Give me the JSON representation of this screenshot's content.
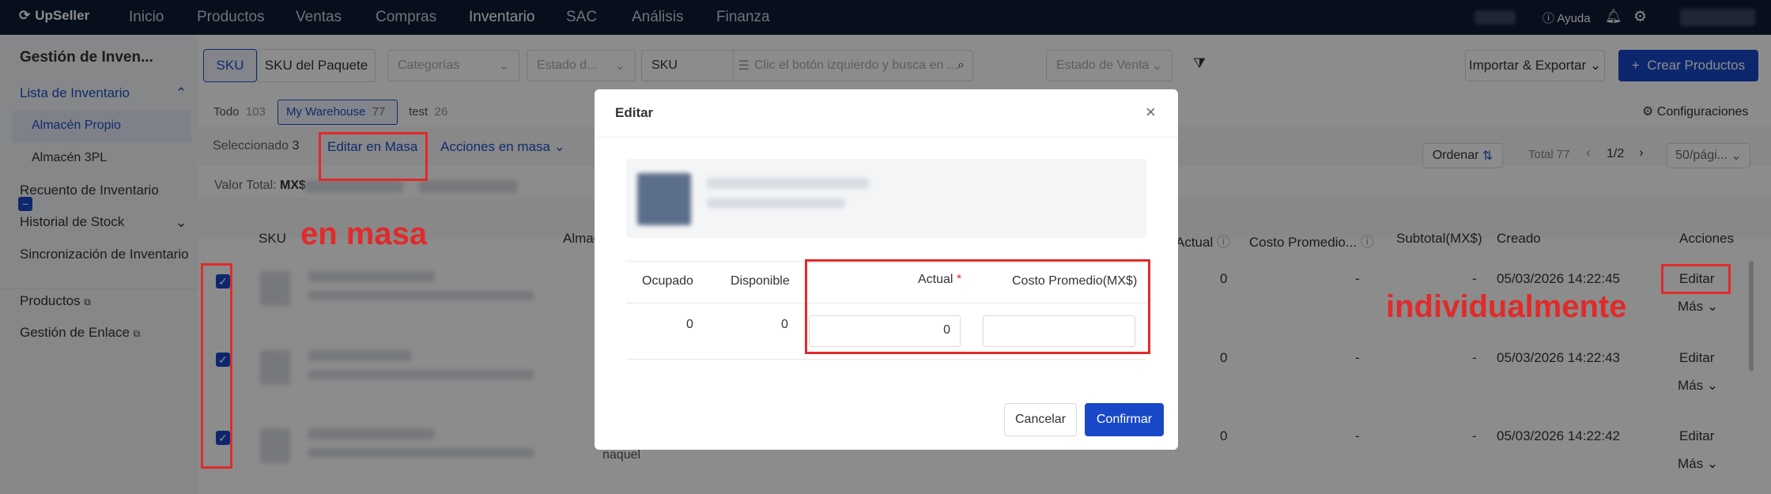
{
  "topbar": {
    "logo": "UpSeller",
    "nav": [
      "Inicio",
      "Productos",
      "Ventas",
      "Compras",
      "Inventario",
      "SAC",
      "Análisis",
      "Finanza"
    ],
    "help": "Ayuda"
  },
  "sidebar": {
    "title": "Gestión de Inven...",
    "items": [
      "Lista de Inventario",
      "Almacén Propio",
      "Almacén 3PL",
      "Recuento de Inventario",
      "Historial de Stock",
      "Sincronización de Inventario",
      "Productos",
      "Gestión de Enlace"
    ]
  },
  "toolbar": {
    "sku_tab": "SKU",
    "package_tab": "SKU del Paquete",
    "categories_ph": "Categorías",
    "status_ph": "Estado d...",
    "sku_select": "SKU",
    "search_ph": "Clic el botón izquierdo y busca en ...",
    "sale_status_ph": "Estado de Venta",
    "import_export": "Importar & Exportar",
    "create": "Crear Productos"
  },
  "warehouses": {
    "all_label": "Todo",
    "all_count": "103",
    "my_label": "My Warehouse",
    "my_count": "77",
    "test_label": "test",
    "test_count": "26",
    "config": "Configuraciones"
  },
  "actions": {
    "selected_label": "Seleccionado",
    "selected_count": "3",
    "bulk_edit": "Editar en Masa",
    "bulk_actions": "Acciones en masa",
    "order": "Ordenar",
    "total": "Total 77",
    "page": "1/2",
    "per_page": "50/pági..."
  },
  "valor": {
    "label": "Valor Total:",
    "currency": "MX$"
  },
  "table": {
    "headers": {
      "sku": "SKU",
      "almacen": "Almac",
      "actual": "Actual",
      "costo": "Costo Promedio...",
      "subtotal": "Subtotal(MX$)",
      "creado": "Creado",
      "acciones": "Acciones"
    },
    "rows": [
      {
        "actual": "0",
        "costo": "-",
        "subtotal": "-",
        "creado": "05/03/2026 14:22:45",
        "edit": "Editar",
        "more": "Más"
      },
      {
        "actual": "0",
        "costo": "-",
        "subtotal": "-",
        "creado": "05/03/2026 14:22:43",
        "edit": "Editar",
        "more": "Más"
      },
      {
        "actual": "0",
        "costo": "-",
        "subtotal": "-",
        "creado": "05/03/2026 14:22:42",
        "edit": "Editar",
        "more": "Más"
      }
    ],
    "row3_loc": "naquel"
  },
  "annotations": {
    "mass": "en masa",
    "individual": "individualmente"
  },
  "modal": {
    "title": "Editar",
    "headers": {
      "ocupado": "Ocupado",
      "disponible": "Disponible",
      "actual": "Actual",
      "costo": "Costo Promedio(MX$)"
    },
    "values": {
      "ocupado": "0",
      "disponible": "0",
      "actual_input": "0",
      "costo_input": ""
    },
    "cancel": "Cancelar",
    "confirm": "Confirmar"
  },
  "colors": {
    "topbar": "#0e1b33",
    "accent": "#1848c8",
    "annotation": "#e12a2a"
  }
}
